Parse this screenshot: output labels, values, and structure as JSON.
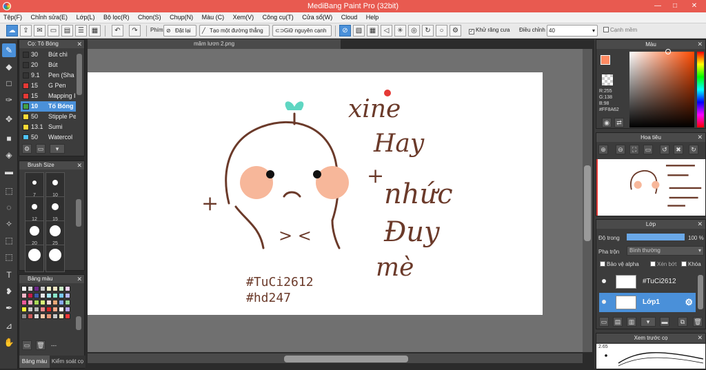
{
  "window": {
    "title": "MediBang Paint Pro (32bit)",
    "minimize": "—",
    "maximize": "□",
    "close": "✕"
  },
  "menu": [
    "Tệp(F)",
    "Chỉnh sửa(E)",
    "Lớp(L)",
    "Bộ lọc(R)",
    "Chọn(S)",
    "Chụp(N)",
    "Màu (C)",
    "Xem(V)",
    "Công cụ(T)",
    "Cửa sổ(W)",
    "Cloud",
    "Help"
  ],
  "toolbar": {
    "brush_label": "Phím",
    "reset_label": "Đặt lại",
    "line_label": "Tạo một đường thẳng",
    "keep_label": "Giữ nguyên cạnh",
    "antialias_label": "Khử răng cưa",
    "adjust_label": "Điều chỉnh",
    "adjust_value": "40",
    "smooth_label": "Cạnh mềm"
  },
  "brush_panel": {
    "title": "Cọ: Tô Bóng",
    "items": [
      {
        "size": "30",
        "name": "Bút chì",
        "color": "#333333"
      },
      {
        "size": "20",
        "name": "Bút",
        "color": "#333333"
      },
      {
        "size": "9.1",
        "name": "Pen (Sha",
        "color": "#333333"
      },
      {
        "size": "15",
        "name": "G Pen",
        "color": "#e53935"
      },
      {
        "size": "15",
        "name": "Mapping I",
        "color": "#e53935"
      },
      {
        "size": "10",
        "name": "Tố Bóng",
        "color": "#43a047"
      },
      {
        "size": "50",
        "name": "Stipple Pe",
        "color": "#fdd835"
      },
      {
        "size": "13.1",
        "name": "Sumi",
        "color": "#fdd835"
      },
      {
        "size": "50",
        "name": "Watercol",
        "color": "#4fc3f7"
      }
    ],
    "selected_index": 5
  },
  "brush_size": {
    "title": "Brush Size",
    "sizes": [
      "7",
      "10",
      "12",
      "15",
      "20",
      "25",
      "",
      ""
    ]
  },
  "palette": {
    "title": "Bảng màu",
    "colors": [
      "#ffffff",
      "#d7d7d7",
      "#6e2a8c",
      "#c7c7c7",
      "#f7f7c8",
      "#f2e5c2",
      "#c8f0c8",
      "#f0d0f0",
      "#f8b8c8",
      "#c21d47",
      "#3a57a8",
      "#e8e8e8",
      "#a8e8f8",
      "#8be8c8",
      "#78c8f8",
      "#b8b8f8",
      "#e85a9a",
      "#f5a5c5",
      "#a8d858",
      "#d8f878",
      "#f8d8d8",
      "#e8a878",
      "#88a8f8",
      "#98d898",
      "#f8f838",
      "#c8c8c8",
      "#b8b8b8",
      "#f88888",
      "#d82828",
      "#f8a888",
      "#f8f8f8",
      "#b8a8f8",
      "#888888",
      "#c85858",
      "#d8d8d8",
      "#f8c8a8",
      "#e89878",
      "#c8c8c8",
      "#f8e8b8",
      "#f83838"
    ],
    "tabs": [
      "Bảng màu",
      "Kiểm soát cọ"
    ],
    "dash": "---"
  },
  "document": {
    "tab": "mãm lươn 2.png"
  },
  "canvas_text": {
    "line1": "xine",
    "line2": "Hay",
    "line3": "nhức",
    "line4": "Đuy",
    "line5": "mè",
    "tag1": "#TuCi2612",
    "tag2": "#hd247",
    "cross": "+",
    "face": "> <"
  },
  "color_panel": {
    "title": "Màu",
    "current": "#ff8a62",
    "r": "R:255",
    "g": "G:138",
    "b": "B:98",
    "hex": "#FF8A62"
  },
  "navigator": {
    "title": "Hoa tiêu"
  },
  "layers_panel": {
    "title": "Lớp",
    "opacity_label": "Độ trong",
    "opacity_value": "100 %",
    "opacity": 1.0,
    "blend_label": "Pha trộn",
    "blend_value": "Bình thường",
    "protect_alpha": "Bảo vệ alpha",
    "clip": "Xén bớt",
    "lock": "Khóa",
    "layers": [
      {
        "name": "#TuCi2612",
        "selected": false
      },
      {
        "name": "Lớp1",
        "selected": true
      }
    ]
  },
  "preview_panel": {
    "title": "Xem trước cọ",
    "size": "2.65"
  }
}
